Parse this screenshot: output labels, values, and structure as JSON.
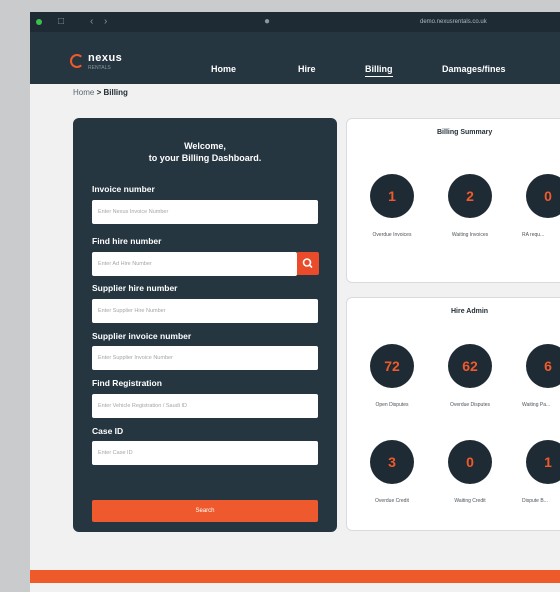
{
  "browser": {
    "url": "demo.nexusrentals.co.uk"
  },
  "nav": {
    "logo_text": "nexus",
    "logo_subtext": "RENTALS",
    "items": [
      {
        "label": "Home"
      },
      {
        "label": "Hire"
      },
      {
        "label": "Billing",
        "active": true
      },
      {
        "label": "Damages/fines"
      }
    ]
  },
  "breadcrumb": {
    "home": "Home",
    "separator": ">",
    "current": "Billing"
  },
  "form": {
    "welcome_line1": "Welcome,",
    "welcome_line2": "to your Billing Dashboard.",
    "fields": [
      {
        "label": "Invoice number",
        "placeholder": "Enter Nexus Invoice Number"
      },
      {
        "label": "Find hire number",
        "placeholder": "Enter Ad Hire Number"
      },
      {
        "label": "Supplier hire number",
        "placeholder": "Enter Supplier Hire Number"
      },
      {
        "label": "Supplier invoice number",
        "placeholder": "Enter Supplier Invoice Number"
      },
      {
        "label": "Find Registration",
        "placeholder": "Enter Vehicle Registration / Saudi ID"
      },
      {
        "label": "Case ID",
        "placeholder": "Enter Case ID"
      }
    ],
    "search_label": "Search"
  },
  "billing_summary": {
    "title": "Billing Summary",
    "stats": [
      {
        "value": "1",
        "label": "Overdue Invoices"
      },
      {
        "value": "2",
        "label": "Waiting Invoices"
      },
      {
        "value": "0",
        "label": "RA requ..."
      }
    ]
  },
  "hire_admin": {
    "title": "Hire Admin",
    "stats": [
      {
        "value": "72",
        "label": "Open Disputes"
      },
      {
        "value": "62",
        "label": "Overdue Disputes"
      },
      {
        "value": "6",
        "label": "Waiting Pa..."
      },
      {
        "value": "3",
        "label": "Overdue Credit"
      },
      {
        "value": "0",
        "label": "Waiting Credit"
      },
      {
        "value": "1",
        "label": "Dispute B..."
      }
    ]
  },
  "colors": {
    "navy": "#253641",
    "accent": "#ef5a2a"
  }
}
